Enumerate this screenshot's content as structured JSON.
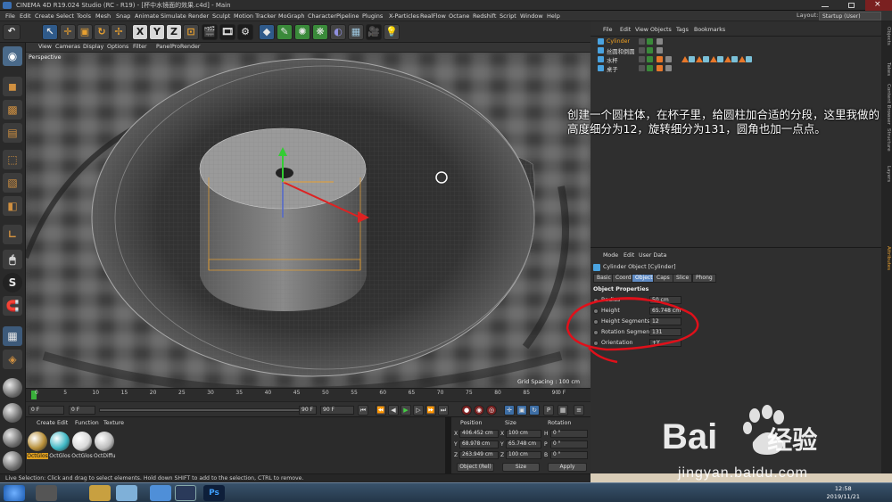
{
  "window": {
    "title": "CINEMA 4D R19.024 Studio (RC - R19) - [杯中水镜面的效果.c4d] - Main"
  },
  "menubar": {
    "items": [
      "File",
      "Edit",
      "Create",
      "Select",
      "Tools",
      "Mesh",
      "Snap",
      "Animate",
      "Simulate",
      "Render",
      "Sculpt",
      "Motion Tracker",
      "MoGraph",
      "Character",
      "Pipeline",
      "Plugins",
      "X-Particles",
      "RealFlow",
      "Octane",
      "Redshift",
      "Script",
      "Window",
      "Help"
    ],
    "layout_label": "Layout:",
    "layout_value": "Startup (User)"
  },
  "toolbar": {
    "axis_x": "X",
    "axis_y": "Y",
    "axis_z": "Z"
  },
  "viewport": {
    "menu": [
      "View",
      "Cameras",
      "Display",
      "Options",
      "Filter",
      "Panel",
      "ProRender"
    ],
    "label": "Perspective",
    "grid_spacing": "Grid Spacing : 100 cm"
  },
  "timeline": {
    "ticks": [
      "0",
      "5",
      "10",
      "15",
      "20",
      "25",
      "30",
      "35",
      "40",
      "45",
      "50",
      "55",
      "60",
      "65",
      "70",
      "75",
      "80",
      "85",
      "90"
    ],
    "end_label": "0 F",
    "start_field": "0 F",
    "min_field": "0 F",
    "max_field": "90 F",
    "end_field": "90 F"
  },
  "material_manager": {
    "menu": [
      "Create",
      "Edit",
      "Function",
      "Texture"
    ],
    "materials": [
      {
        "name": "OctGlos",
        "color": "#b8903a"
      },
      {
        "name": "OctGlos",
        "color": "#3fb7c4"
      },
      {
        "name": "OctGlos",
        "color": "#d9d9d9"
      },
      {
        "name": "OctDiffu",
        "color": "#bdbdbd"
      }
    ]
  },
  "coordinates": {
    "headers": [
      "Position",
      "Size",
      "Rotation"
    ],
    "rows": [
      {
        "axis": "X",
        "position": "406.452 cm",
        "saxis": "X",
        "size": "100 cm",
        "raxis": "H",
        "rotation": "0 °"
      },
      {
        "axis": "Y",
        "position": "68.978 cm",
        "saxis": "Y",
        "size": "65.748 cm",
        "raxis": "P",
        "rotation": "0 °"
      },
      {
        "axis": "Z",
        "position": "263.949 cm",
        "saxis": "Z",
        "size": "100 cm",
        "raxis": "B",
        "rotation": "0 °"
      }
    ],
    "mode_select": "Object (Rel)",
    "size_select": "Size",
    "apply_label": "Apply"
  },
  "object_manager": {
    "menu": [
      "File",
      "Edit",
      "View",
      "Objects",
      "Tags",
      "Bookmarks"
    ],
    "objects": [
      {
        "name": "Cylinder",
        "selected": true,
        "color": "#4aa3e0"
      },
      {
        "name": "丝圆和倒圆",
        "selected": false,
        "color": "#4aa3e0"
      },
      {
        "name": "水杯",
        "selected": false,
        "color": "#4aa3e0"
      },
      {
        "name": "桌子",
        "selected": false,
        "color": "#4aa3e0"
      }
    ]
  },
  "attribute_manager": {
    "menu": [
      "Mode",
      "Edit",
      "User Data"
    ],
    "object_title": "Cylinder Object [Cylinder]",
    "tabs": [
      "Basic",
      "Coord.",
      "Object",
      "Caps",
      "Slice",
      "Phong"
    ],
    "active_tab": "Object",
    "section": "Object Properties",
    "properties": [
      {
        "label": "Radius",
        "value": "50 cm"
      },
      {
        "label": "Height",
        "value": "65.748 cm"
      },
      {
        "label": "Height Segments",
        "value": "12"
      },
      {
        "label": "Rotation Segments",
        "value": "131"
      },
      {
        "label": "Orientation",
        "value": "+Y"
      }
    ]
  },
  "side_tabs": [
    "Objects",
    "Takes",
    "Content Browser",
    "Structure",
    "Layers",
    "Attributes"
  ],
  "status": {
    "text": "Live Selection: Click and drag to select elements. Hold down SHIFT to add to the selection, CTRL to remove."
  },
  "taskbar": {
    "time": "12:58",
    "date": "2019/11/21"
  },
  "annotation": {
    "text": "创建一个圆柱体，在杯子里，给圆柱加合适的分段，这里我做的高度细分为12，旋转细分为131，圆角也加一点点。"
  },
  "watermark": {
    "logo_text": "Bai",
    "logo_suffix": "经验",
    "url": "jingyan.baidu.com"
  },
  "colors": {
    "accent_orange": "#f0a020",
    "annotation_red": "#e0101a",
    "active_tab": "#5f8bc4"
  }
}
